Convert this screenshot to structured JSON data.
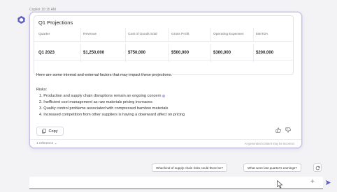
{
  "message": {
    "meta": "Copilot  10:15 AM",
    "table_title": "Q1 Projections",
    "table": {
      "columns": [
        "Quarter",
        "Revenue",
        "Cost of Goods Sold",
        "Gross Profit",
        "Operating Expenses",
        "EBITDA"
      ],
      "rows": [
        [
          "Q1 2023",
          "$1,250,000",
          "$750,000",
          "$500,000",
          "$300,000",
          "$200,000"
        ]
      ]
    },
    "intro": "Here are some internal and external factors that may impact these projections.",
    "risks_heading": "Risks:",
    "risks": [
      "1. Production and supply chain disruptions remain an ongoing concern",
      "2. Inefficient cost management as raw materials pricing increases",
      "3. Quality control problems associated with compressed bamboo materials",
      "4. Increased competition from other suppliers is having a downward affect on pricing"
    ],
    "copy_label": "Copy",
    "references_label": "1 reference",
    "disclaimer": "AI-generated content may be incorrect"
  },
  "suggestions": [
    "What kind of supply chain risks could there be?",
    "What were last quarter's earnings?"
  ],
  "compose": {
    "placeholder": "",
    "value": ""
  },
  "icons": {
    "avatar": "copilot-logo-icon",
    "copy": "copy-icon",
    "like": "thumbs-up-icon",
    "dislike": "thumbs-down-icon",
    "refresh": "refresh-icon",
    "add": "plus-icon",
    "send": "send-icon"
  },
  "colors": {
    "accent": "#5b5fc7",
    "card_border": "#c9c2e8",
    "background": "#f3f2f5"
  }
}
